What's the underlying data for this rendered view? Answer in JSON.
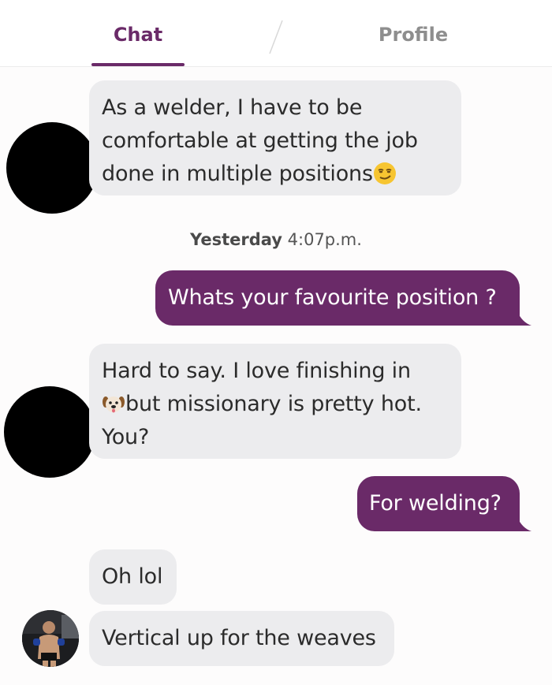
{
  "tabs": {
    "chat_label": "Chat",
    "profile_label": "Profile"
  },
  "colors": {
    "accent": "#6a2a68",
    "received_bubble": "#ececee",
    "inactive_tab": "#8e8e8e"
  },
  "messages": {
    "m1_line1": "As a welder, I have to be",
    "m1_line2": "comfortable at getting the job",
    "m1_line3": "done in multiple positions",
    "m1_emoji": "smirking-face-emoji",
    "timestamp_day": "Yesterday",
    "timestamp_time": "4:07p.m.",
    "m2": "Whats your favourite position ?",
    "m3_line1": "Hard to say. I love finishing in",
    "m3_emoji": "dog-face-emoji",
    "m3_line2": "but missionary is pretty hot.",
    "m3_line3": "You?",
    "m4": "For welding?",
    "m5": "Oh lol",
    "m6": "Vertical up for the weaves"
  }
}
